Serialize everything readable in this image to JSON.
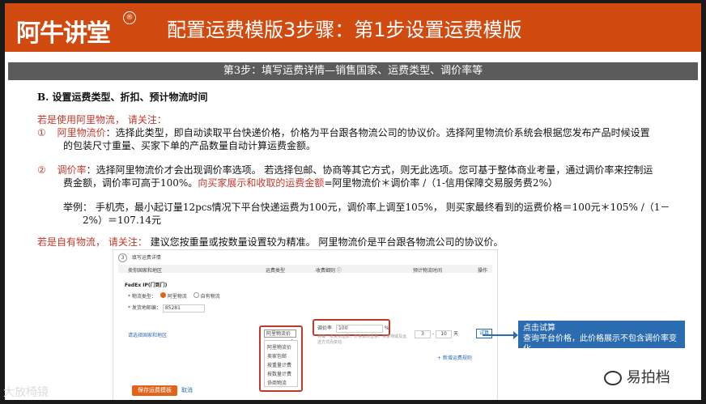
{
  "header": {
    "logo_text": "阿牛讲堂",
    "logo_badge": "®",
    "title": "配置运费模版3步骤：第1步设置运费模版"
  },
  "subheader": "第3步：填写运费详情—销售国家、运费类型、调价率等",
  "section_b": "B.  设置运费类型、折扣、预计物流时间",
  "aliship": {
    "heading": "若是使用阿里物流，  请关注：",
    "item1_num": "①",
    "item1_label": "阿里物流价",
    "item1_text": "：选择此类型，即自动读取平台快递价格，价格为平台跟各物流公司的协议价。选择阿里物流价系统会根据您发布产品时候设置",
    "item1_text2": "的包装尺寸重量、买家下单的产品数量自动计算运费金额。",
    "item2_num": "②",
    "item2_label": "调价率",
    "item2_text": "：选择阿里物流价才会出现调价率选项。  若选择包邮、协商等其它方式，则无此选项。您可基于整体商业考量，通过调价率来控制运",
    "item2_text2a": "费金额，调价率可高于100%。",
    "item2_text2b": "向买家展示和收取的运费金额",
    "item2_text2c": "=阿里物流价＊调价率 /（1-信用保障交易服务费2%）",
    "example_line1": "举例：   手机壳，最小起订量12pcs情况下平台快递运费为100元，调价率上调至105%，  则买家最终看到的运费价格＝100元＊105% /（1－",
    "example_line2": "2%）＝107.14元"
  },
  "self": {
    "heading": "若是自有物流，  请关注：",
    "text": "  建议您按重量或按数量设置较为精准。  阿里物流价是平台跟各物流公司的协议价。"
  },
  "screenshot": {
    "step_num": "3",
    "step_title": "填写运费详情",
    "col1": "卖你国家和地区",
    "col2": "运费类型",
    "col3": "收费细则 ⓘ",
    "col4": "预计物流时间",
    "col5": "操作",
    "carrier": "FedEx IP(门到门)",
    "logistics_type_label": "* 物流类型：",
    "opt_ali": "阿里物流",
    "opt_self": "自有物流",
    "zip_label": "* 发货地邮编：",
    "zip_value": "85281",
    "region_link": "请选择国家和地区",
    "type_select": "阿里物流价",
    "adjust_label": "调价率",
    "adjust_value": "100",
    "adjust_unit": "%",
    "note": "将每一批货物运费，价格会随重量、买家地域及运送方式而变动",
    "time_from": "3",
    "time_to": "10",
    "time_unit": "天",
    "trial_button": "试算",
    "dropdown": [
      "阿里物流价",
      "卖家包邮",
      "按重量计费",
      "按数量计费",
      "协商物流"
    ],
    "add_rule": "+ 新增运费规则",
    "save_button": "保存运费模板",
    "cancel_link": "取消"
  },
  "tooltip": {
    "line1": "点击试算",
    "line2": "查询平台价格，此价格展示不包含调价率变化"
  },
  "watermark": "易拍档",
  "corner_overlay": "大放椅镜"
}
